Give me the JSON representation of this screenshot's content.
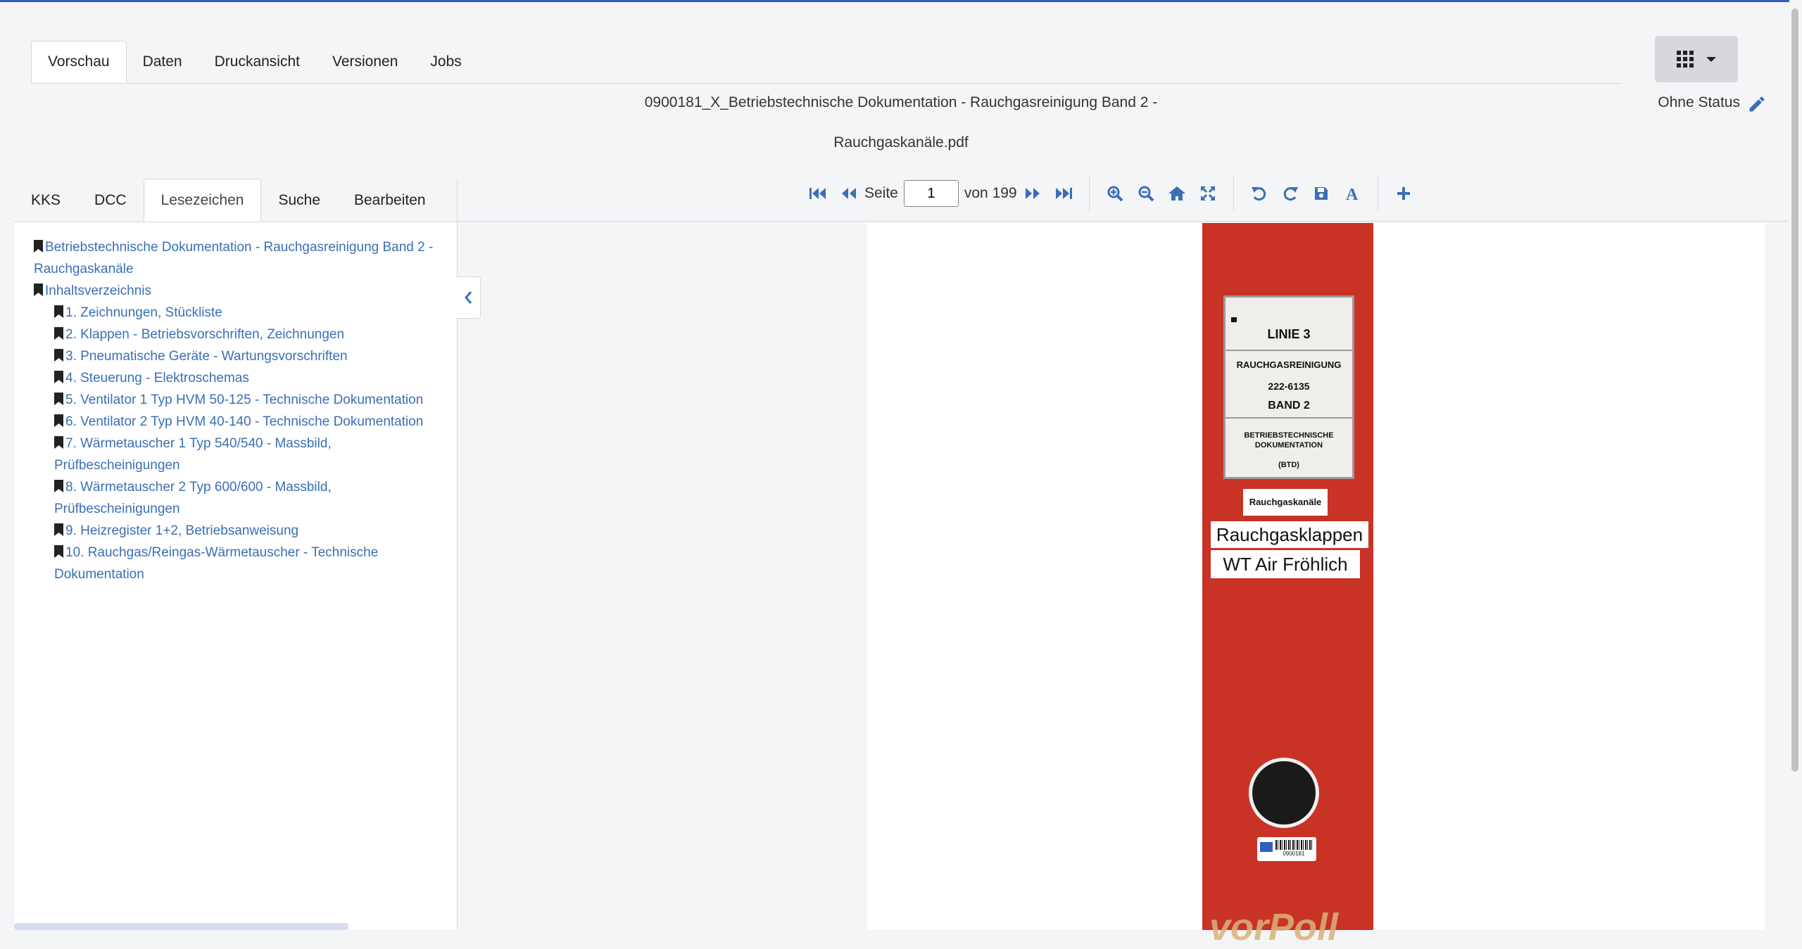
{
  "top_tabs": [
    "Vorschau",
    "Daten",
    "Druckansicht",
    "Versionen",
    "Jobs"
  ],
  "document": {
    "title_line1": "0900181_X_Betriebstechnische Dokumentation - Rauchgasreinigung Band 2 -",
    "title_line2": "Rauchgaskanäle.pdf",
    "status": "Ohne Status"
  },
  "left_tabs": [
    "KKS",
    "DCC",
    "Lesezeichen",
    "Suche",
    "Bearbeiten"
  ],
  "bookmarks": [
    {
      "label": "Betriebstechnische Dokumentation - Rauchgasreinigung Band 2 -",
      "cont": "Rauchgaskanäle",
      "level": 1
    },
    {
      "label": "Inhaltsverzeichnis",
      "level": 1
    },
    {
      "label": "1. Zeichnungen, Stückliste",
      "level": 2
    },
    {
      "label": "2. Klappen - Betriebsvorschriften, Zeichnungen",
      "level": 2
    },
    {
      "label": "3. Pneumatische Geräte - Wartungsvorschriften",
      "level": 2
    },
    {
      "label": "4. Steuerung - Elektroschemas",
      "level": 2
    },
    {
      "label": "5. Ventilator 1 Typ HVM 50-125 - Technische Dokumentation",
      "level": 2
    },
    {
      "label": "6. Ventilator 2 Typ HVM 40-140 - Technische Dokumentation",
      "level": 2
    },
    {
      "label": "7. Wärmetauscher 1 Typ 540/540 - Massbild,",
      "cont": "Prüfbescheinigungen",
      "level": 2
    },
    {
      "label": "8. Wärmetauscher 2 Typ 600/600 - Massbild,",
      "cont": "Prüfbescheinigungen",
      "level": 2
    },
    {
      "label": "9. Heizregister 1+2, Betriebsanweisung",
      "level": 2
    },
    {
      "label": "10. Rauchgas/Reingas-Wärmetauscher - Technische",
      "cont": "Dokumentation",
      "level": 2
    }
  ],
  "toolbar": {
    "page_label": "Seite",
    "page_value": "1",
    "of_label": "von 199"
  },
  "binder": {
    "label_linie": "LINIE  3",
    "label_rauch": "RAUCHGASREINIGUNG",
    "label_nr": "222-6135",
    "label_band": "BAND  2",
    "label_btd1": "BETRIEBSTECHNISCHE",
    "label_btd2": "DOKUMENTATION",
    "label_btd3": "(BTD)",
    "sticker1": "Rauchgaskanäle",
    "sticker2": "Rauchgasklappen",
    "sticker3": "WT Air Fröhlich",
    "barcode_nr": "0900181",
    "brand": "vorPoll"
  }
}
